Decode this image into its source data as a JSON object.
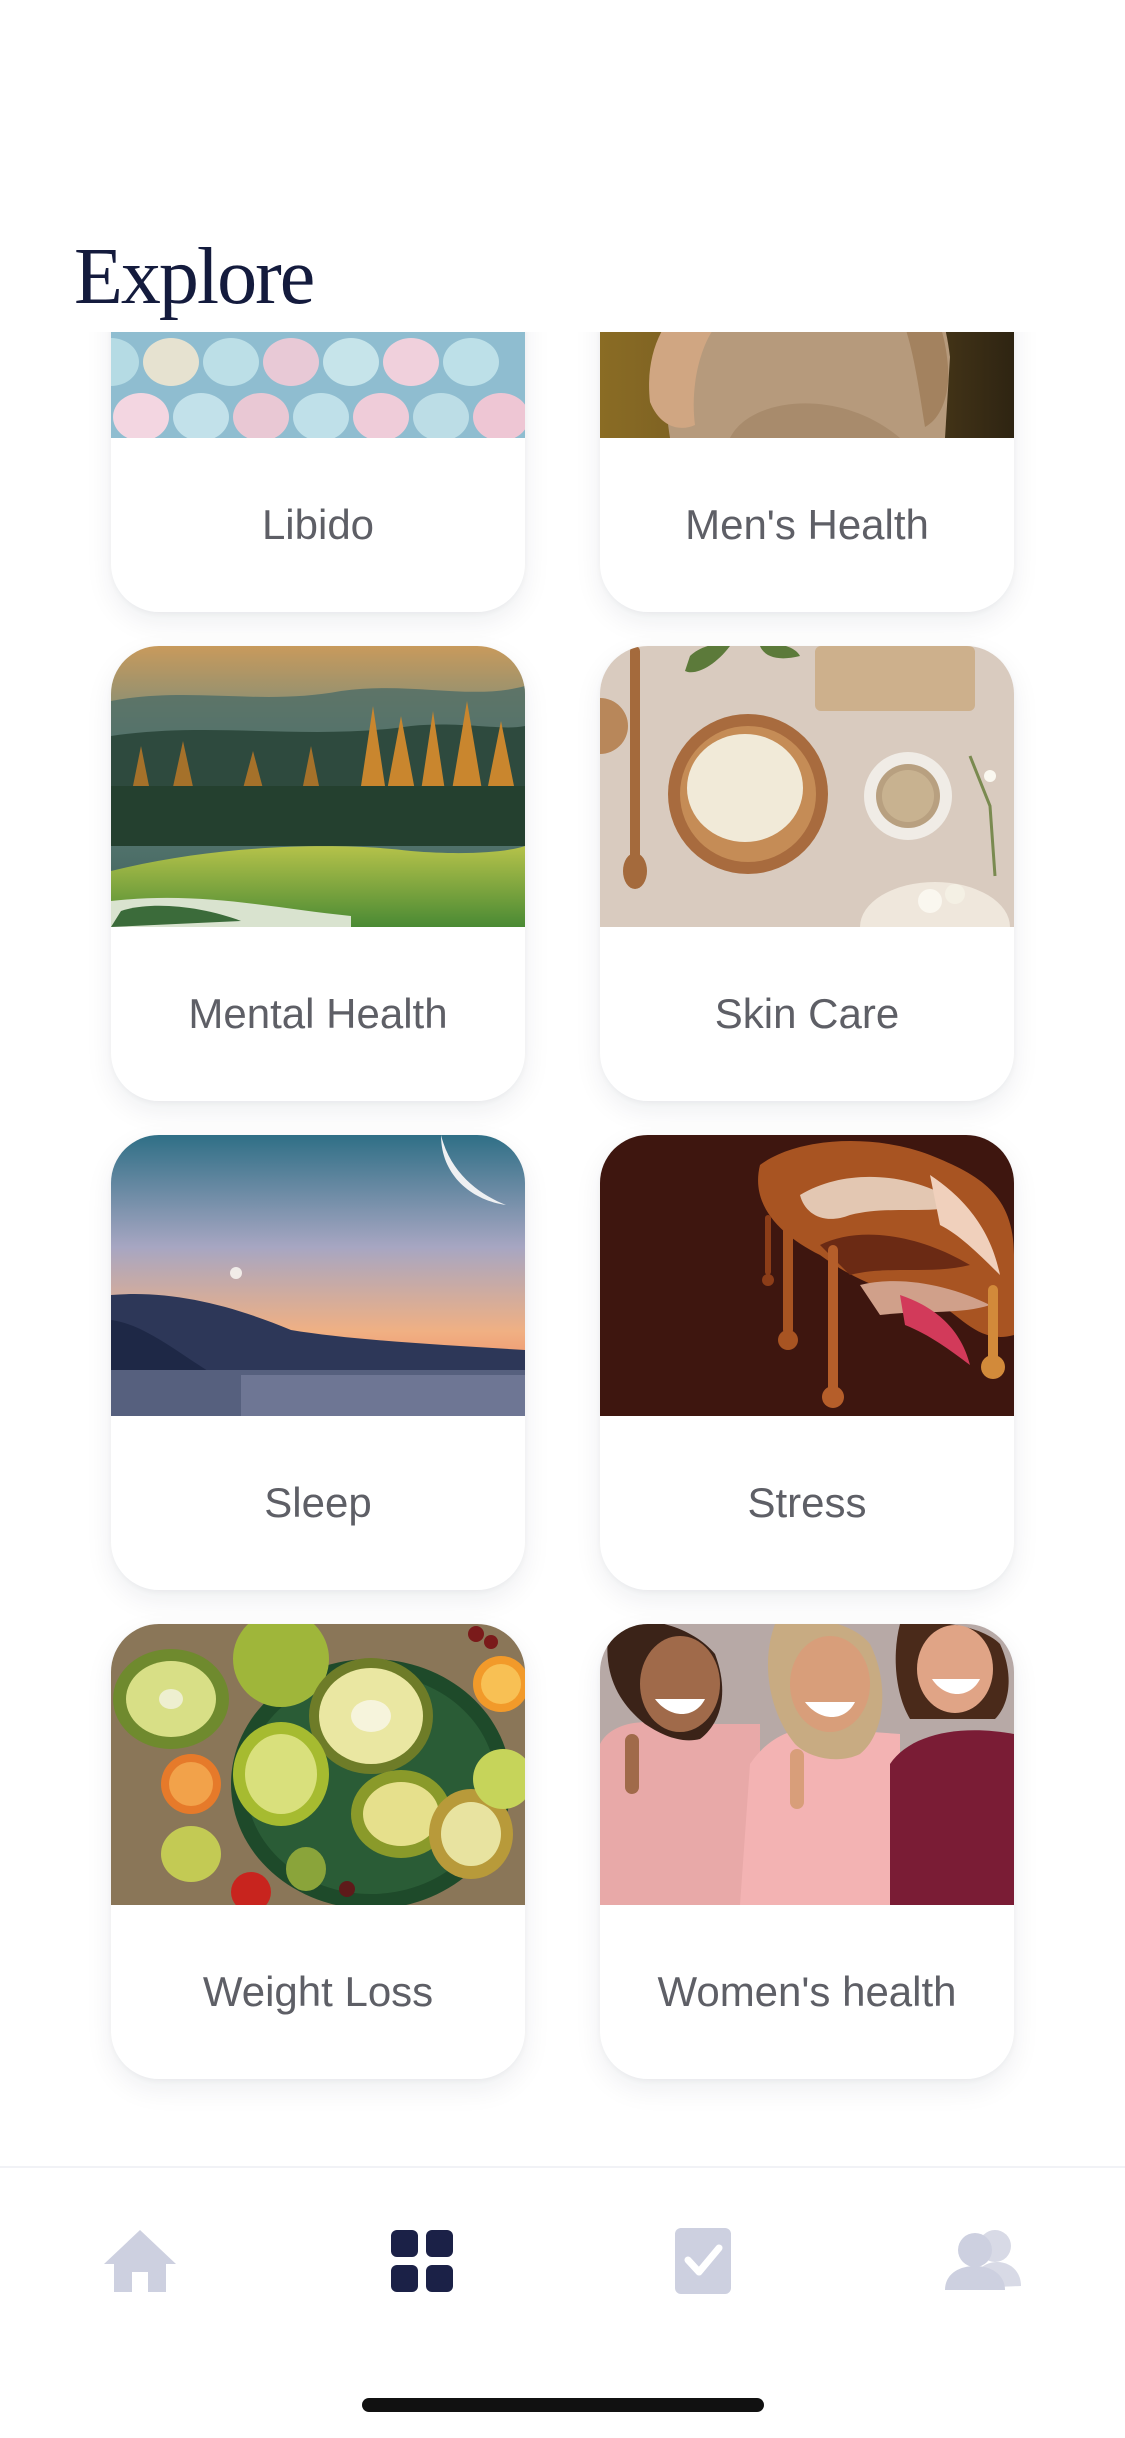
{
  "header": {
    "title": "Explore"
  },
  "cards": [
    {
      "label": "Libido",
      "image": "colorful-pills"
    },
    {
      "label": "Men's Health",
      "image": "man-torso"
    },
    {
      "label": "Mental Health",
      "image": "forest-landscape"
    },
    {
      "label": "Skin Care",
      "image": "soap-bar-flatlay"
    },
    {
      "label": "Sleep",
      "image": "dusk-sky-lake"
    },
    {
      "label": "Stress",
      "image": "melting-chocolate"
    },
    {
      "label": "Weight Loss",
      "image": "kiwi-fruits"
    },
    {
      "label": "Women's health",
      "image": "smiling-women"
    }
  ],
  "tab_bar": {
    "tabs": [
      {
        "name": "home",
        "icon": "home-icon",
        "active": false
      },
      {
        "name": "explore",
        "icon": "grid-icon",
        "active": true
      },
      {
        "name": "tasks",
        "icon": "checkbox-icon",
        "active": false
      },
      {
        "name": "community",
        "icon": "people-icon",
        "active": false
      }
    ],
    "active_color": "#1b2147",
    "inactive_color": "#cdd0e0"
  }
}
